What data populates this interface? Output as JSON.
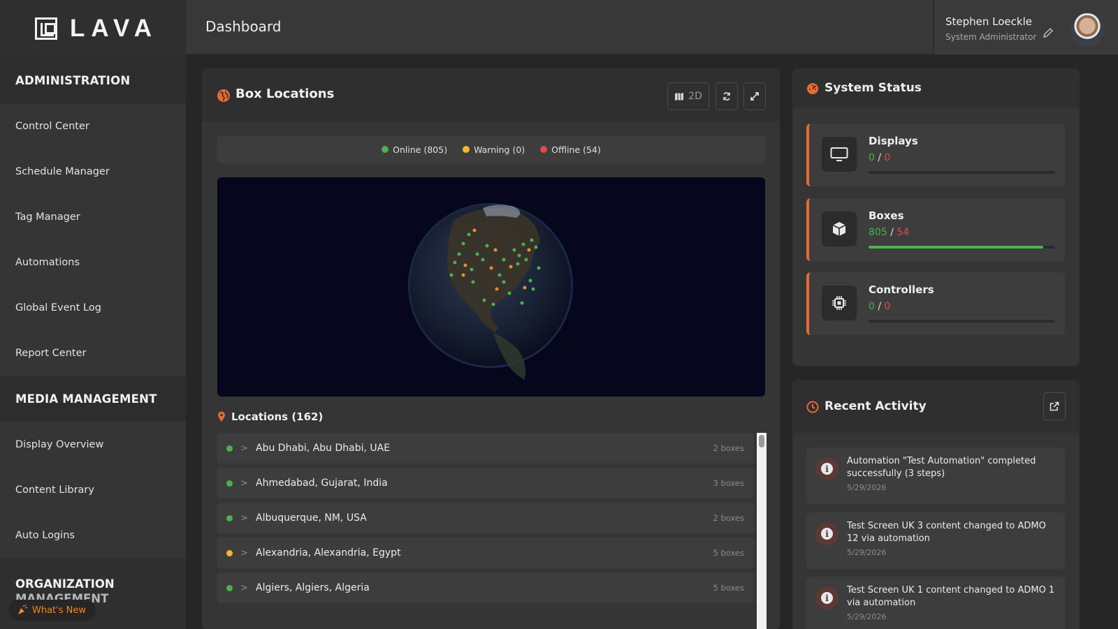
{
  "brand": {
    "name": "LAVA"
  },
  "header": {
    "title": "Dashboard"
  },
  "user": {
    "name": "Stephen Loeckle",
    "role": "System Administrator"
  },
  "sidebar": {
    "sections": [
      {
        "title": "ADMINISTRATION",
        "items": [
          "Control Center",
          "Schedule Manager",
          "Tag Manager",
          "Automations",
          "Global Event Log",
          "Report Center"
        ]
      },
      {
        "title": "MEDIA MANAGEMENT",
        "items": [
          "Display Overview",
          "Content Library",
          "Auto Logins"
        ]
      }
    ],
    "org_section": {
      "line1": "ORGANIZATION",
      "line2": "MANAGEMENT"
    },
    "whats_new": "What's New"
  },
  "box_locations": {
    "title": "Box Locations",
    "view_toggle": "2D",
    "legend": [
      {
        "label": "Online (805)",
        "color": "#4caf50"
      },
      {
        "label": "Warning (0)",
        "color": "#f5b82e"
      },
      {
        "label": "Offline (54)",
        "color": "#e04a4a"
      }
    ],
    "locations_title": "Locations (162)",
    "locations": [
      {
        "name": "Abu Dhabi, Abu Dhabi, UAE",
        "count": "2 boxes",
        "status_color": "#4caf50"
      },
      {
        "name": "Ahmedabad, Gujarat, India",
        "count": "3 boxes",
        "status_color": "#4caf50"
      },
      {
        "name": "Albuquerque, NM, USA",
        "count": "2 boxes",
        "status_color": "#4caf50"
      },
      {
        "name": "Alexandria, Alexandria, Egypt",
        "count": "5 boxes",
        "status_color": "#f5b82e"
      },
      {
        "name": "Algiers, Algiers, Algeria",
        "count": "5 boxes",
        "status_color": "#4caf50"
      }
    ]
  },
  "system_status": {
    "title": "System Status",
    "cards": [
      {
        "title": "Displays",
        "online": "0",
        "sep": "/",
        "offline": "0",
        "progress": 0,
        "icon": "monitor-icon"
      },
      {
        "title": "Boxes",
        "online": "805",
        "sep": "/",
        "offline": "54",
        "progress": 0.937,
        "icon": "box-icon"
      },
      {
        "title": "Controllers",
        "online": "0",
        "sep": "/",
        "offline": "0",
        "progress": 0,
        "icon": "chip-icon"
      }
    ]
  },
  "recent_activity": {
    "title": "Recent Activity",
    "items": [
      {
        "text": "Automation \"Test Automation\" completed successfully (3 steps)",
        "date": "5/29/2026"
      },
      {
        "text": "Test Screen UK 3 content changed to ADMO 12 via automation",
        "date": "5/29/2026"
      },
      {
        "text": "Test Screen UK 1 content changed to ADMO 1 via automation",
        "date": "5/29/2026"
      }
    ]
  }
}
